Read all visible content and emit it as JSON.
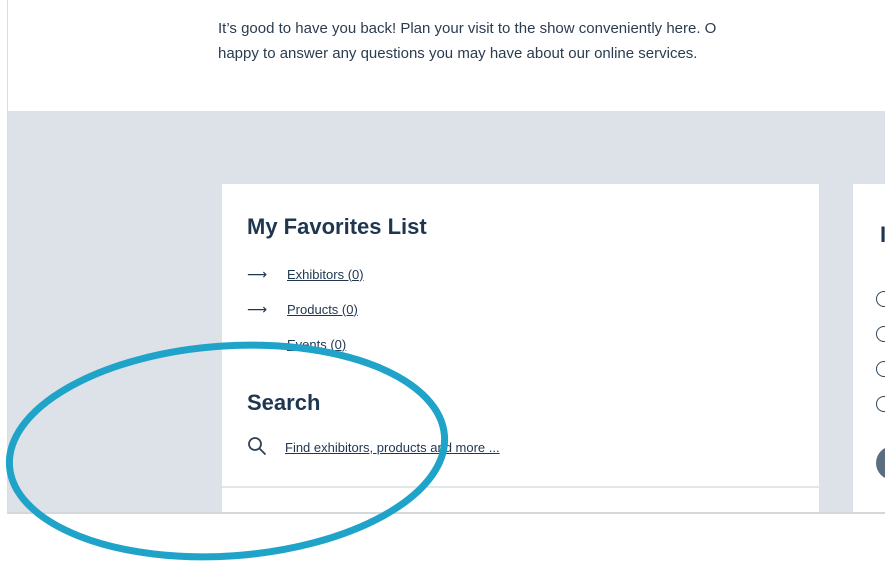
{
  "intro": {
    "line1": "It’s good to have you back! Plan your visit to the show conveniently here. O",
    "line2": "happy to answer any questions you may have about our online services."
  },
  "favorites": {
    "title": "My Favorites List",
    "items": [
      {
        "label": "Exhibitors (0)",
        "icon": "arrow-right-icon"
      },
      {
        "label": "Products (0)",
        "icon": "arrow-right-icon"
      },
      {
        "label": "Events (0)",
        "icon": "arrow-right-icon"
      }
    ]
  },
  "search": {
    "title": "Search",
    "link": "Find exhibitors, products and more ...",
    "icon": "search-icon"
  },
  "second_card": {
    "heading_fragment": "I"
  },
  "annotation": {
    "shape": "ellipse",
    "color": "#1fa3c9"
  },
  "colors": {
    "text": "#1f3650",
    "page_bg": "#dce2e7",
    "card_bg": "#ffffff"
  }
}
